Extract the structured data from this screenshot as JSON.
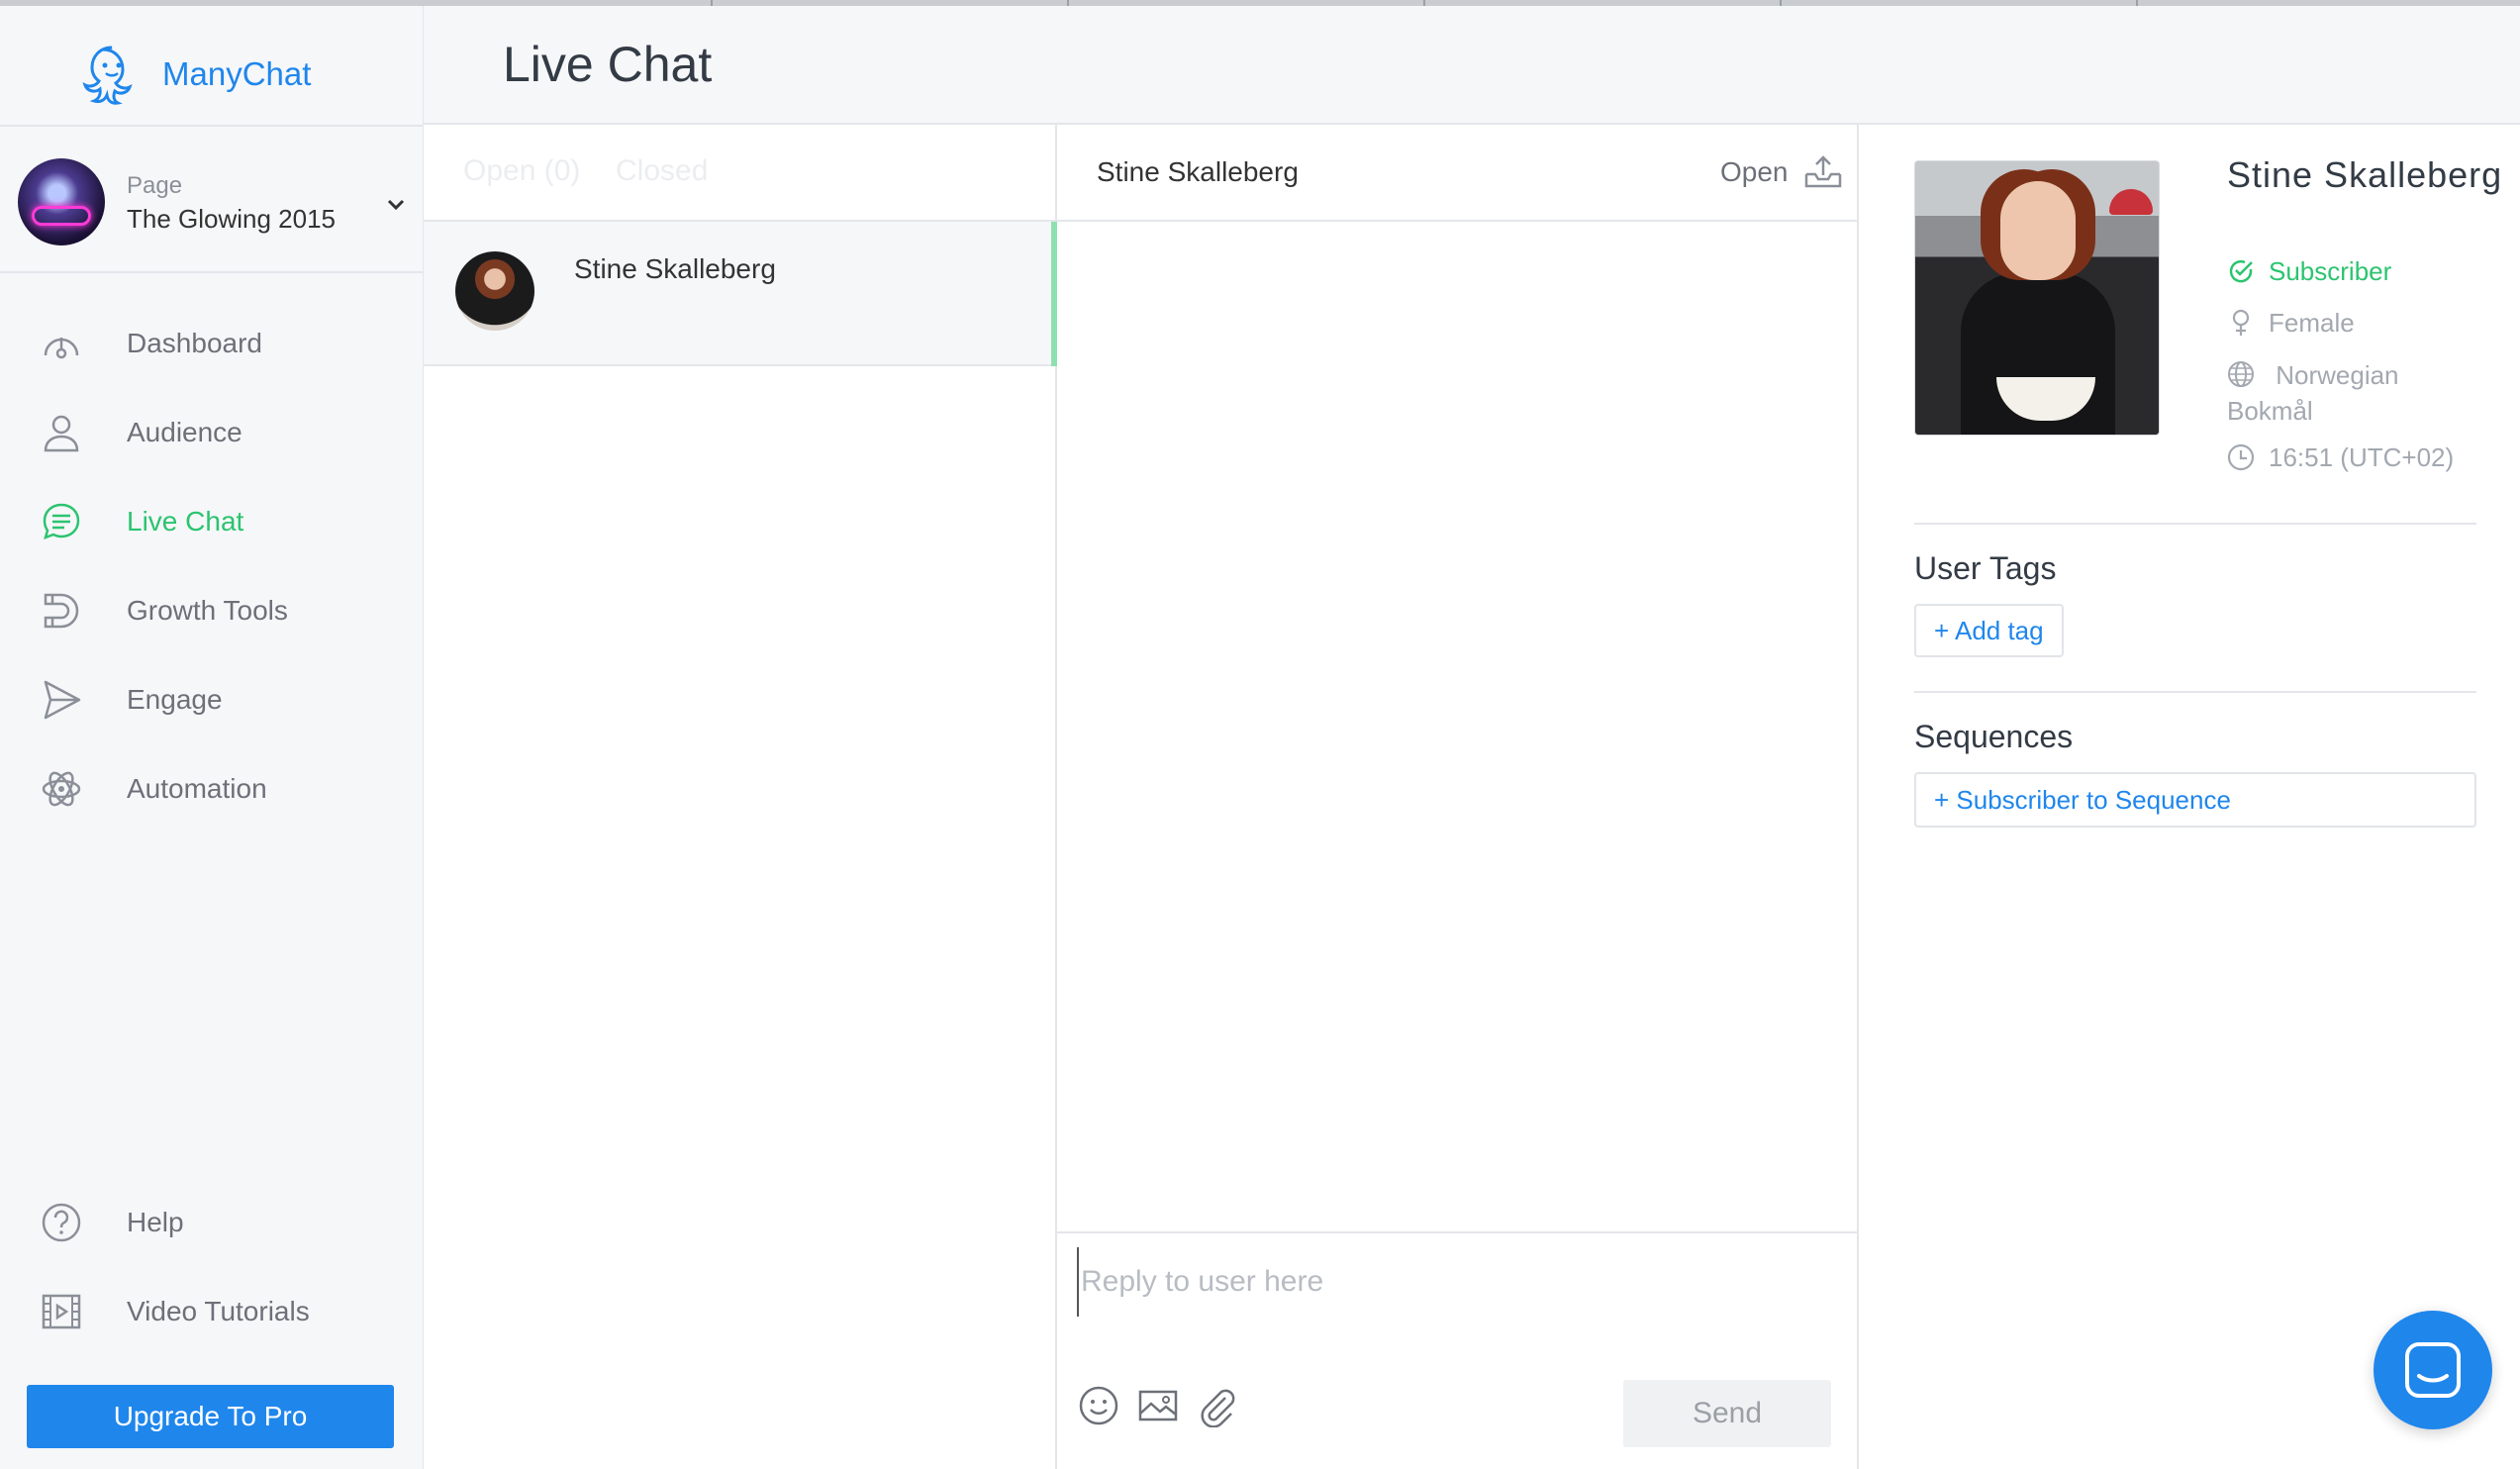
{
  "app": {
    "name": "ManyChat",
    "brand_color": "#1f86ec",
    "active_color": "#2bc46f"
  },
  "page": {
    "label": "Page",
    "name": "The Glowing 2015"
  },
  "nav": {
    "items": [
      {
        "label": "Dashboard",
        "icon": "gauge-icon"
      },
      {
        "label": "Audience",
        "icon": "user-icon"
      },
      {
        "label": "Live Chat",
        "icon": "chat-bubble-icon",
        "active": true
      },
      {
        "label": "Growth Tools",
        "icon": "magnet-icon"
      },
      {
        "label": "Engage",
        "icon": "send-icon"
      },
      {
        "label": "Automation",
        "icon": "atom-icon"
      }
    ],
    "bottom": [
      {
        "label": "Help",
        "icon": "help-icon"
      },
      {
        "label": "Video Tutorials",
        "icon": "film-icon"
      }
    ],
    "upgrade_label": "Upgrade To Pro"
  },
  "header": {
    "title": "Live Chat"
  },
  "conversations": {
    "tabs": [
      {
        "label": "Open (0)"
      },
      {
        "label": "Closed"
      }
    ],
    "items": [
      {
        "name": "Stine Skalleberg"
      }
    ]
  },
  "chat": {
    "user_name": "Stine Skalleberg",
    "status": "Open",
    "reply_placeholder": "Reply to user here",
    "send_label": "Send"
  },
  "profile": {
    "name": "Stine Skalleberg",
    "status": "Subscriber",
    "gender": "Female",
    "language": "Norwegian Bokmål",
    "time": "16:51 (UTC+02)",
    "tags_title": "User Tags",
    "add_tag_label": "+ Add tag",
    "sequences_title": "Sequences",
    "add_sequence_label": "+ Subscriber to Sequence"
  }
}
